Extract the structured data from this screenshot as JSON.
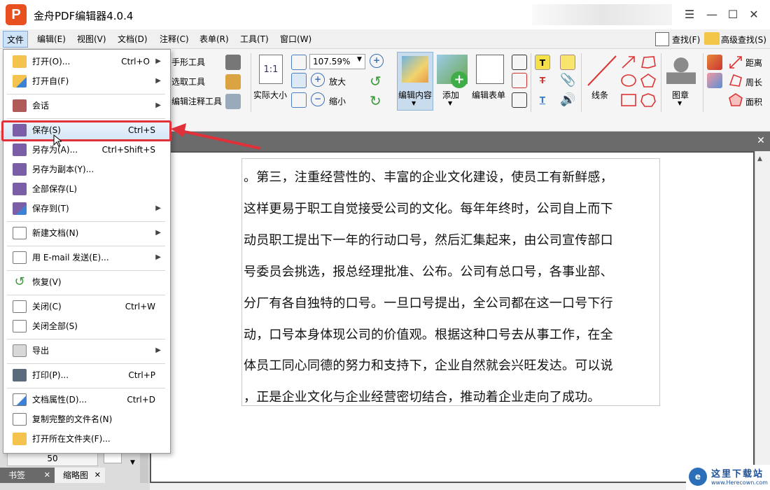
{
  "window": {
    "title": "金舟PDF编辑器4.0.4",
    "logo": "P"
  },
  "menubar": {
    "items": [
      "文件",
      "编辑(E)",
      "视图(V)",
      "文档(D)",
      "注释(C)",
      "表单(R)",
      "工具(T)",
      "窗口(W)"
    ],
    "find": "查找(F)",
    "advanced_find": "高级查找(S)"
  },
  "toolbar": {
    "hand_tool": "手形工具",
    "select_tool": "选取工具",
    "edit_annot_tool": "编辑注释工具",
    "actual_size": "实际大小",
    "zoom_value": "107.59%",
    "zoom_in": "放大",
    "zoom_out": "缩小",
    "edit_content": "编辑内容",
    "add": "添加",
    "edit_form": "编辑表单",
    "lines": "线条",
    "stamp": "图章",
    "distance": "距离",
    "perimeter": "周长",
    "area": "面积"
  },
  "file_menu": {
    "items": [
      {
        "label": "打开(O)...",
        "shortcut": "Ctrl+O",
        "arrow": true
      },
      {
        "label": "打开自(F)",
        "shortcut": "",
        "arrow": true
      },
      {
        "label": "会话",
        "shortcut": "",
        "arrow": true
      },
      {
        "label": "保存(S)",
        "shortcut": "Ctrl+S",
        "arrow": false
      },
      {
        "label": "另存为(A)...",
        "shortcut": "Ctrl+Shift+S",
        "arrow": false
      },
      {
        "label": "另存为副本(Y)...",
        "shortcut": "",
        "arrow": false
      },
      {
        "label": "全部保存(L)",
        "shortcut": "",
        "arrow": false
      },
      {
        "label": "保存到(T)",
        "shortcut": "",
        "arrow": true
      },
      {
        "label": "新建文档(N)",
        "shortcut": "",
        "arrow": true
      },
      {
        "label": "用 E-mail 发送(E)...",
        "shortcut": "",
        "arrow": true
      },
      {
        "label": "恢复(V)",
        "shortcut": "",
        "arrow": false
      },
      {
        "label": "关闭(C)",
        "shortcut": "Ctrl+W",
        "arrow": false
      },
      {
        "label": "关闭全部(S)",
        "shortcut": "",
        "arrow": false
      },
      {
        "label": "导出",
        "shortcut": "",
        "arrow": true
      },
      {
        "label": "打印(P)...",
        "shortcut": "Ctrl+P",
        "arrow": false
      },
      {
        "label": "文档属性(D)...",
        "shortcut": "Ctrl+D",
        "arrow": false
      },
      {
        "label": "复制完整的文件名(N)",
        "shortcut": "",
        "arrow": false
      },
      {
        "label": "打开所在文件夹(F)...",
        "shortcut": "",
        "arrow": false
      }
    ]
  },
  "document": {
    "lines": [
      "。第三，注重经营性的、丰富的企业文化建设，使员工有新鲜感，",
      "这样更易于职工自觉接受公司的文化。每年年终时，公司自上而下",
      "动员职工提出下一年的行动口号，然后汇集起来，由公司宣传部口",
      "号委员会挑选，报总经理批准、公布。公司有总口号，各事业部、",
      "分厂有各自独特的口号。一旦口号提出，全公司都在这一口号下行",
      "动，口号本身体现公司的价值观。根据这种口号去从事工作，在全",
      "体员工同心同德的努力和支持下，企业自然就会兴旺发达。可以说",
      "，正是企业文化与企业经营密切结合，推动着企业走向了成功。"
    ]
  },
  "left_panel": {
    "page_value": "50",
    "tabs": [
      "书签",
      "缩略图"
    ]
  },
  "watermark": {
    "title": "这里下载站",
    "url": "www.Herecown.com"
  }
}
